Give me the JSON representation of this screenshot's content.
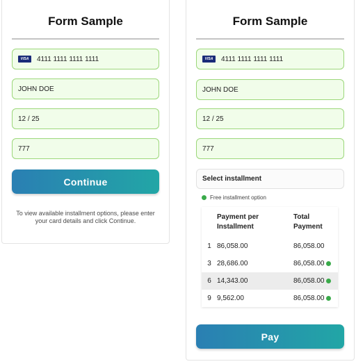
{
  "left_form": {
    "title": "Form Sample",
    "card_number": "4111 1111 1111 1111",
    "card_brand": "VISA",
    "card_holder": "JOHN DOE",
    "expiry": "12 / 25",
    "cvv": "777",
    "continue_label": "Continue",
    "helper_text": "To view available installment options, please enter your card details and click Continue."
  },
  "right_form": {
    "title": "Form Sample",
    "card_number": "4111 1111 1111 1111",
    "card_brand": "VISA",
    "card_holder": "JOHN DOE",
    "expiry": "12 / 25",
    "cvv": "777",
    "select_label": "Select installment",
    "free_option_label": "Free installment option",
    "table": {
      "headers": [
        "",
        "Payment per Installment",
        "Total Payment"
      ],
      "rows": [
        {
          "count": "1",
          "per_installment": "86,058.00",
          "total": "86,058.00",
          "free": false,
          "highlighted": false
        },
        {
          "count": "3",
          "per_installment": "28,686.00",
          "total": "86,058.00",
          "free": true,
          "highlighted": false
        },
        {
          "count": "6",
          "per_installment": "14,343.00",
          "total": "86,058.00",
          "free": true,
          "highlighted": true
        },
        {
          "count": "9",
          "per_installment": "9,562.00",
          "total": "86,058.00",
          "free": true,
          "highlighted": false
        }
      ]
    },
    "pay_label": "Pay"
  },
  "colors": {
    "field_bg": "#f1fdea",
    "field_border": "#9cd77a",
    "button_gradient_start": "#2a7fb3",
    "button_gradient_end": "#22a6a6",
    "free_dot": "#3aaa4a",
    "visa_blue": "#1a2a78"
  }
}
